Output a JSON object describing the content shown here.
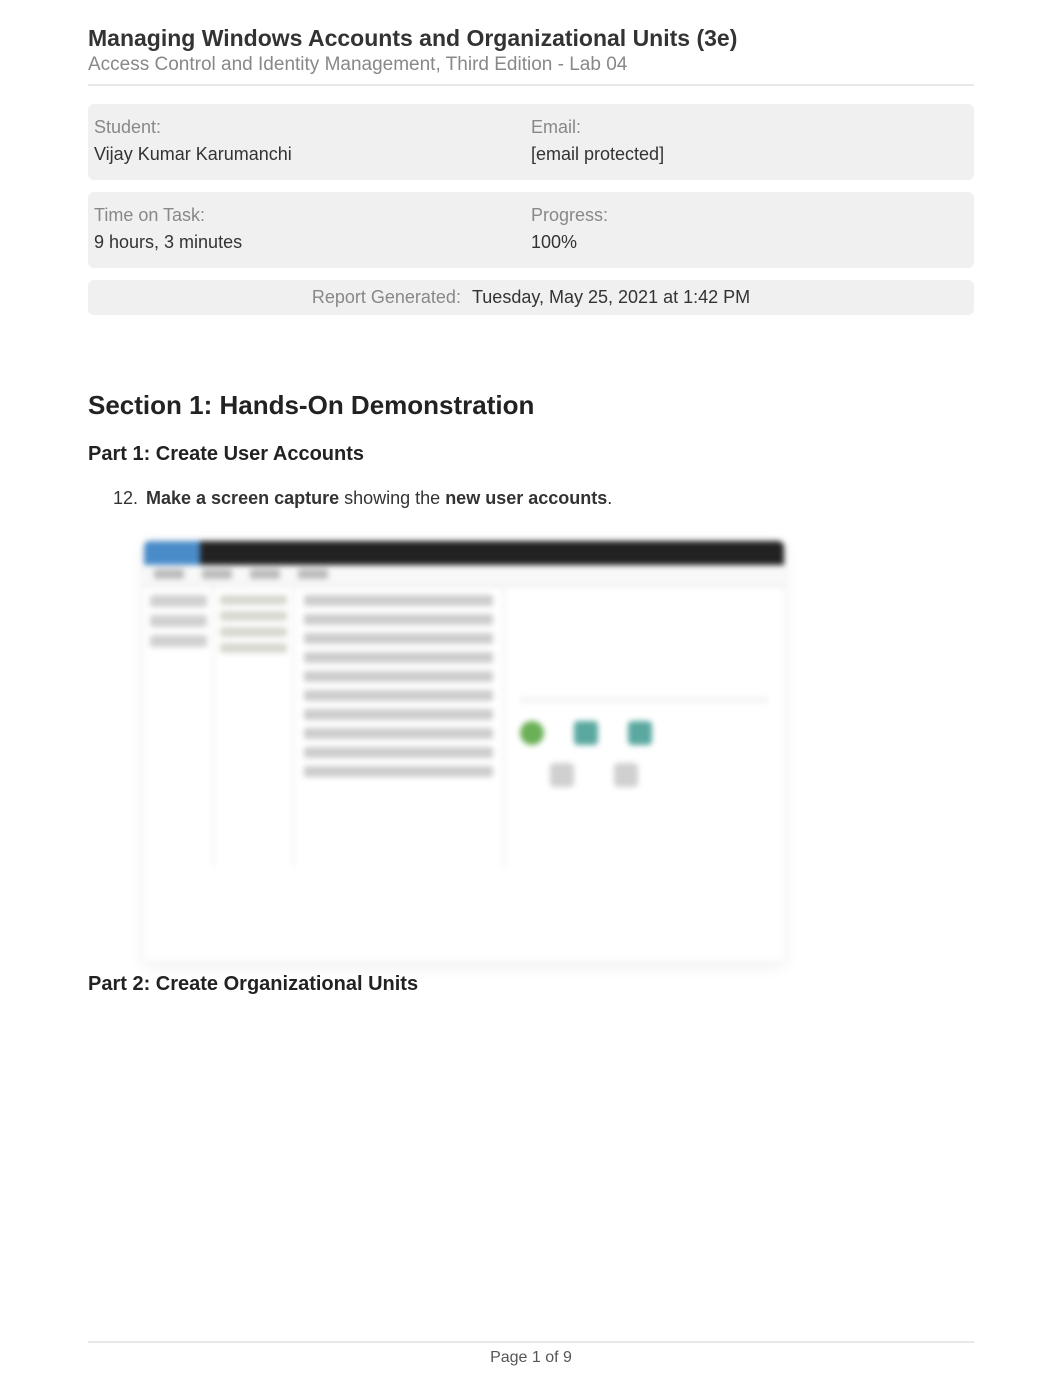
{
  "header": {
    "title": "Managing Windows Accounts and Organizational Units (3e)",
    "subtitle": "Access Control and Identity Management, Third Edition - Lab 04"
  },
  "info": {
    "student_label": "Student:",
    "student_value": "Vijay Kumar Karumanchi",
    "email_label": "Email:",
    "email_value": "[email protected]",
    "time_label": "Time on Task:",
    "time_value": "9 hours, 3 minutes",
    "progress_label": "Progress:",
    "progress_value": "100%"
  },
  "report": {
    "label": "Report Generated:",
    "value": "Tuesday, May 25, 2021 at 1:42 PM"
  },
  "section1": {
    "heading": "Section 1: Hands-On Demonstration",
    "part1": {
      "heading": "Part 1: Create User Accounts",
      "task": {
        "number": "12.",
        "bold1": "Make a screen capture",
        "mid": " showing the ",
        "bold2": "new user accounts",
        "end": "."
      }
    },
    "part2": {
      "heading": "Part 2: Create Organizational Units"
    }
  },
  "footer": {
    "page": "Page 1 of 9"
  }
}
